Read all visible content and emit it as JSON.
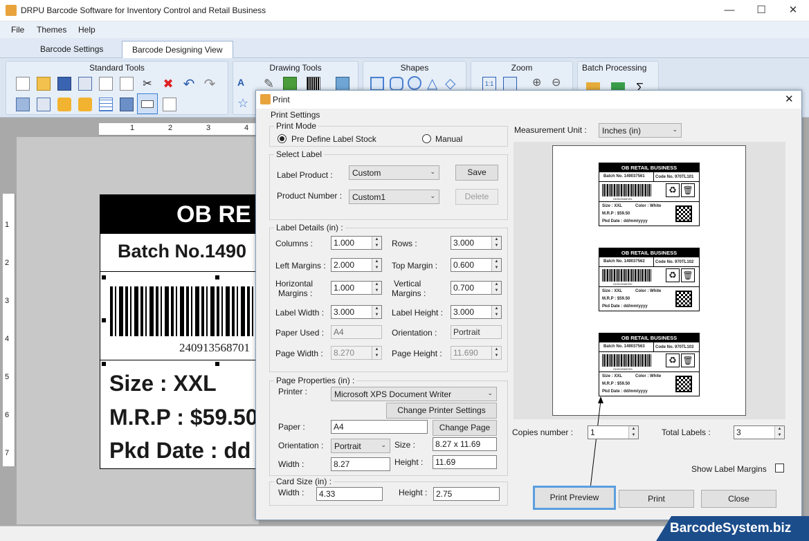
{
  "window": {
    "title": "DRPU Barcode Software for Inventory Control and Retail Business"
  },
  "menu": {
    "file": "File",
    "themes": "Themes",
    "help": "Help"
  },
  "tabs": {
    "settings": "Barcode Settings",
    "designing": "Barcode Designing View"
  },
  "ribbon": {
    "standard_tools": "Standard Tools",
    "drawing_tools": "Drawing Tools",
    "shapes": "Shapes",
    "zoom": "Zoom",
    "batch_processing": "Batch Processing"
  },
  "ruler": {
    "h": [
      "1",
      "2",
      "3",
      "4"
    ],
    "v": [
      "1",
      "2",
      "3",
      "4",
      "5",
      "6",
      "7"
    ]
  },
  "label_preview": {
    "header": "OB RE",
    "batch": "Batch No.1490",
    "barcode_number": "240913568701",
    "size": "Size : XXL",
    "mrp": "M.R.P : $59.50",
    "pkd": "Pkd Date : dd"
  },
  "dialog": {
    "title": "Print",
    "print_settings": "Print Settings",
    "print_mode": {
      "legend": "Print Mode",
      "predefine": "Pre Define Label Stock",
      "manual": "Manual",
      "selected": "predefine"
    },
    "select_label": {
      "legend": "Select Label",
      "label_product_lbl": "Label Product :",
      "label_product": "Custom",
      "product_number_lbl": "Product Number :",
      "product_number": "Custom1",
      "save": "Save",
      "delete": "Delete"
    },
    "label_details": {
      "legend": "Label Details (in) :",
      "columns_lbl": "Columns :",
      "columns": "1.000",
      "rows_lbl": "Rows :",
      "rows": "3.000",
      "left_margins_lbl": "Left Margins :",
      "left_margins": "2.000",
      "top_margin_lbl": "Top Margin :",
      "top_margin": "0.600",
      "horizontal_margins_lbl1": "Horizontal",
      "horizontal_margins_lbl2": "Margins :",
      "horizontal_margins": "1.000",
      "vertical_margins_lbl1": "Vertical",
      "vertical_margins_lbl2": "Margins :",
      "vertical_margins": "0.700",
      "label_width_lbl": "Label Width :",
      "label_width": "3.000",
      "label_height_lbl": "Label Height :",
      "label_height": "3.000",
      "paper_used_lbl": "Paper Used :",
      "paper_used": "A4",
      "orientation_lbl": "Orientation :",
      "orientation": "Portrait",
      "page_width_lbl": "Page Width :",
      "page_width": "8.270",
      "page_height_lbl": "Page Height :",
      "page_height": "11.690"
    },
    "page_properties": {
      "legend": "Page Properties (in) :",
      "printer_lbl": "Printer :",
      "printer": "Microsoft XPS Document Writer",
      "change_printer": "Change Printer Settings",
      "paper_lbl": "Paper :",
      "paper": "A4",
      "change_page": "Change Page",
      "orientation_lbl": "Orientation :",
      "orientation": "Portrait",
      "size_lbl": "Size :",
      "size": "8.27 x 11.69",
      "width_lbl": "Width :",
      "width": "8.27",
      "height_lbl": "Height :",
      "height": "11.69"
    },
    "card_size": {
      "legend": "Card Size (in) :",
      "width_lbl": "Width :",
      "width": "4.33",
      "height_lbl": "Height :",
      "height": "2.75"
    },
    "measurement_unit_lbl": "Measurement Unit :",
    "measurement_unit": "Inches (in)",
    "preview_labels": [
      {
        "header": "OB RETAIL BUSINESS",
        "batch": "Batch No. 149037561",
        "code": "Code No. 970TL101",
        "num": "2409135687Ø1",
        "size": "Size : XXL",
        "color": "Color : White",
        "mrp": "M.R.P : $59.50",
        "pkd": "Pkd Date : dd/mm/yyyy"
      },
      {
        "header": "OB RETAIL BUSINESS",
        "batch": "Batch No. 149037562",
        "code": "Code No. 970TL102",
        "num": "2409135687Ø2",
        "size": "Size : XXL",
        "color": "Color : White",
        "mrp": "M.R.P : $59.50",
        "pkd": "Pkd Date : dd/mm/yyyy"
      },
      {
        "header": "OB RETAIL BUSINESS",
        "batch": "Batch No. 149037563",
        "code": "Code No. 970TL103",
        "num": "2409135687Ø3",
        "size": "Size : XXL",
        "color": "Color : White",
        "mrp": "M.R.P : $59.50",
        "pkd": "Pkd Date : dd/mm/yyyy"
      }
    ],
    "copies_number_lbl": "Copies number :",
    "copies_number": "1",
    "total_labels_lbl": "Total Labels :",
    "total_labels": "3",
    "show_label_margins": "Show Label Margins",
    "print_preview": "Print Preview",
    "print": "Print",
    "close": "Close"
  },
  "banner": "BarcodeSystem.biz"
}
